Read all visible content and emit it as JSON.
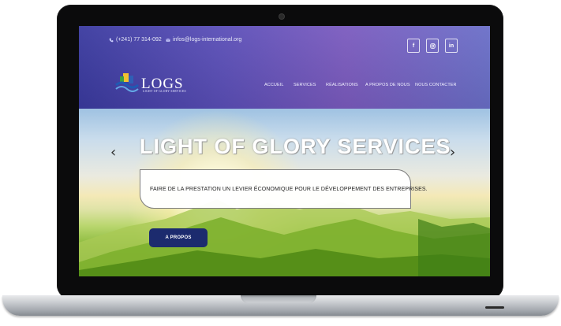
{
  "header": {
    "phone": "(+241) 77 314-092",
    "email": "infos@logs-international.org",
    "social": [
      "f",
      "ig",
      "in"
    ]
  },
  "logo": {
    "text": "LOGS",
    "subtitle": "LIGHT OF GLORY SERVICES"
  },
  "nav": {
    "items": [
      "ACCUEIL",
      "SERVICES",
      "RÉALISATIONS",
      "A PROPOS DE NOUS",
      "NOUS CONTACTER"
    ]
  },
  "hero": {
    "title": "LIGHT OF GLORY SERVICES",
    "tagline": "FAIRE DE LA PRESTATION UN LEVIER ÉCONOMIQUE POUR LE DÉVELOPPEMENT DES ENTREPRISES.",
    "cta": "A PROPOS",
    "prev_arrow": "‹",
    "next_arrow": "›"
  },
  "icons": {
    "phone": "phone-icon",
    "mail": "mail-icon",
    "facebook": "facebook-icon",
    "instagram": "instagram-icon",
    "linkedin": "linkedin-icon"
  },
  "colors": {
    "header_bg": "#5b4fb8",
    "cta_bg": "#1c2b6e",
    "nav_text": "#f1f1ff"
  }
}
